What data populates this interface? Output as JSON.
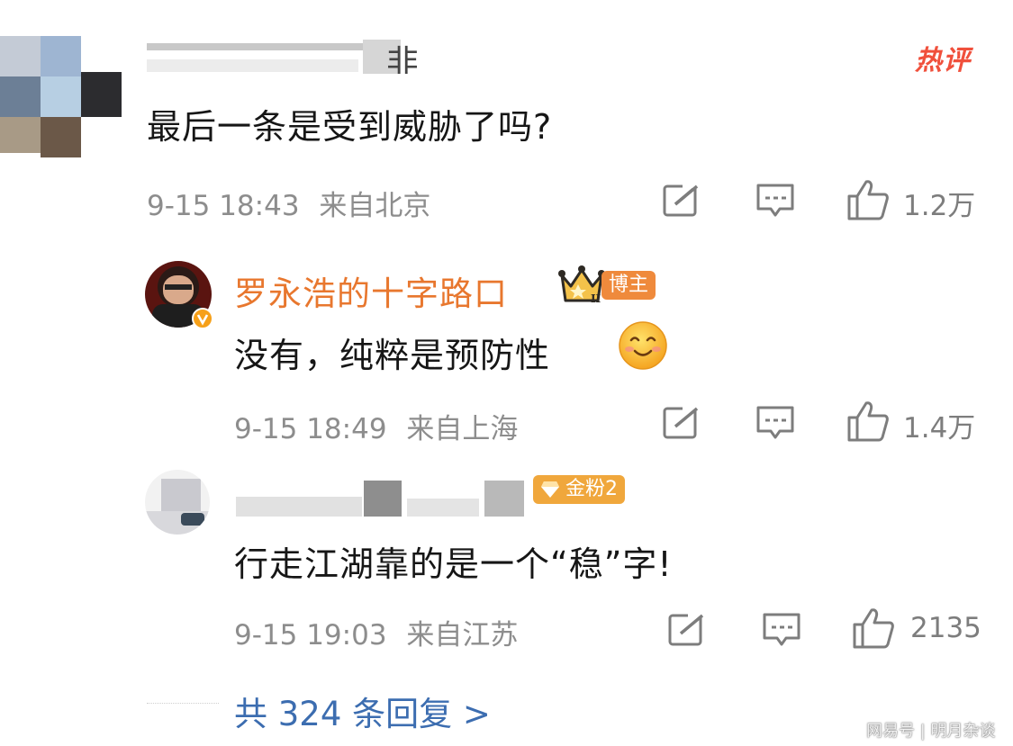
{
  "hot_badge": "热评",
  "comments": [
    {
      "username_fragment": "非",
      "text": "最后一条是受到威胁了吗?",
      "time": "9-15 18:43",
      "location": "来自北京",
      "likes": "1.2万"
    },
    {
      "username": "罗永浩的十字路口",
      "author_badge": "博主",
      "text": "没有，纯粹是预防性",
      "emoji": "smile-emoji",
      "time": "9-15 18:49",
      "location": "来自上海",
      "likes": "1.4万"
    },
    {
      "fan_badge": "金粉2",
      "text": "行走江湖靠的是一个“稳”字!",
      "time": "9-15 19:03",
      "location": "来自江苏",
      "likes": "2135"
    }
  ],
  "more_replies": "共 324 条回复 >",
  "watermark": "网易号 | 明月杂谈",
  "colors": {
    "username_orange": "#e8772e",
    "link_blue": "#3c6db0",
    "hot_red": "#f0503c",
    "fan_gold": "#f0a73c",
    "meta_gray": "#8d8d8d"
  }
}
